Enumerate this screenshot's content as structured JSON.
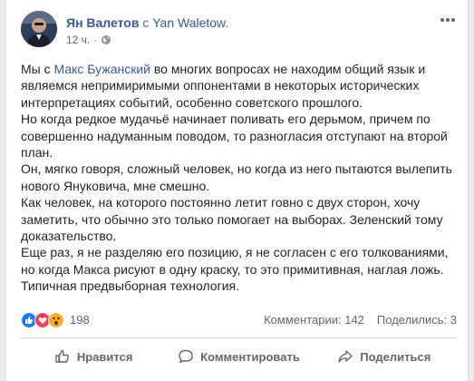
{
  "post": {
    "author": "Ян Валетов",
    "with_text": "с",
    "target": "Yan Waletow.",
    "time": "12 ч.",
    "dot": "·",
    "privacy_icon": "globe-icon",
    "more_icon": "more-icon",
    "line1_pre": "Мы с ",
    "line1_mention": "Макс Бужанский",
    "line1_post": " во многих вопросах не находим общий язык и являемся непримиримыми оппонентами в некоторых исторических интерпретациях событий, особенно советского прошлого.",
    "line2": "Но когда редкое мудачьё начинает поливать его дерьмом, причем по совершенно надуманным поводом, то разногласия отступают на второй план.",
    "line3": "Он, мягко говоря, сложный человек, но когда из него пытаются вылепить нового Януковича, мне смешно.",
    "line4": "Как человек, на которого постоянно летит говно с двух сторон, хочу заметить, что обычно это только помогает на выборах. Зеленский тому доказательство.",
    "line5": "Еще раз, я не разделяю его позицию, я не согласен с его толкованиями, но когда Макса рисуют в одну краску, то это примитивная, наглая ложь. Типичная предвыборная технология."
  },
  "stats": {
    "reaction_icons": [
      "like-icon",
      "love-icon",
      "wow-icon"
    ],
    "reaction_count": "198",
    "comments": "Комментарии: 142",
    "shares": "Поделились: 3"
  },
  "actions": {
    "like": "Нравится",
    "comment": "Комментировать",
    "share": "Поделиться"
  },
  "colors": {
    "link": "#385898",
    "text": "#1d2129",
    "muted": "#606770",
    "like": "#1877f2",
    "love": "#f33e58",
    "wow": "#f7b125"
  }
}
